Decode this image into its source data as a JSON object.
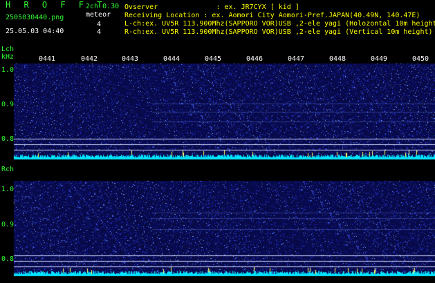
{
  "header": {
    "app_title": "H R O F F T",
    "filename": "2505030440.png",
    "datetime": "25.05.03 04:40",
    "mode": "2ch 0.30",
    "event_label": "meteor",
    "lch_count": "4",
    "rch_count": "4",
    "observer": "Ovserver              : ex. JR7CYX [ kid ]",
    "location": "Receiving Location : ex. Aomori City Aomori-Pref.JAPAN(40.49N, 140.47E)",
    "lch_info": "L-ch:ex. UV5R 113.900Mhz(SAPPORO VOR)USB ,2-ele yagi (Holozontal 10m height)",
    "rch_info": "R-ch:ex. UV5R 113.900Mhz(SAPPORO VOR)USB ,2-ele yagi (Vertical 10m height)"
  },
  "panels": {
    "lch": {
      "label": "Lch",
      "unit": "kHz",
      "ticks": [
        "1.0",
        "0.9",
        "0.8"
      ]
    },
    "rch": {
      "label": "Rch",
      "ticks": [
        "1.0",
        "0.9",
        "0.8"
      ]
    }
  },
  "time_ticks": [
    "0441",
    "0442",
    "0443",
    "0444",
    "0445",
    "0446",
    "0447",
    "0448",
    "0449",
    "0450"
  ],
  "colors": {
    "background": "#000000",
    "green_text": "#33ff33",
    "white_text": "#ffffff",
    "time_label": "#ffff00",
    "waterfall_base": "#0a0a4a",
    "noise_floor": "#00e5ff"
  }
}
